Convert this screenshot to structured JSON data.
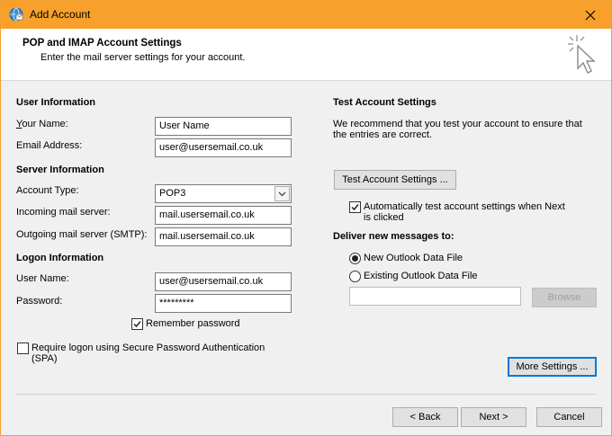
{
  "window": {
    "title": "Add Account"
  },
  "header": {
    "title": "POP and IMAP Account Settings",
    "subtitle": "Enter the mail server settings for your account."
  },
  "user_info": {
    "section_title": "User Information",
    "your_name_label": "Your Name:",
    "your_name_value": "User Name",
    "email_label": "Email Address:",
    "email_value": "user@usersemail.co.uk"
  },
  "server_info": {
    "section_title": "Server Information",
    "account_type_label": "Account Type:",
    "account_type_value": "POP3",
    "incoming_label": "Incoming mail server:",
    "incoming_value": "mail.usersemail.co.uk",
    "outgoing_label": "Outgoing mail server (SMTP):",
    "outgoing_value": "mail.usersemail.co.uk"
  },
  "logon_info": {
    "section_title": "Logon Information",
    "user_name_label": "User Name:",
    "user_name_value": "user@usersemail.co.uk",
    "password_label": "Password:",
    "password_value": "*********",
    "remember_label": "Remember password",
    "remember_checked": true,
    "spa_label_line1": "Require logon using Secure Password Authentication",
    "spa_label_line2": "(SPA)",
    "spa_checked": false
  },
  "test_settings": {
    "section_title": "Test Account Settings",
    "description_line1": "We recommend that you test your account to ensure that",
    "description_line2": "the entries are correct.",
    "test_button": "Test Account Settings ...",
    "auto_test_line1": "Automatically test account settings when Next",
    "auto_test_line2": "is clicked",
    "auto_test_checked": true
  },
  "deliver": {
    "section_title": "Deliver new messages to:",
    "new_file_label": "New Outlook Data File",
    "existing_file_label": "Existing Outlook Data File",
    "selected": "new",
    "browse_button": "Browse"
  },
  "buttons": {
    "more_settings": "More Settings ...",
    "back": "< Back",
    "next": "Next >",
    "cancel": "Cancel"
  }
}
